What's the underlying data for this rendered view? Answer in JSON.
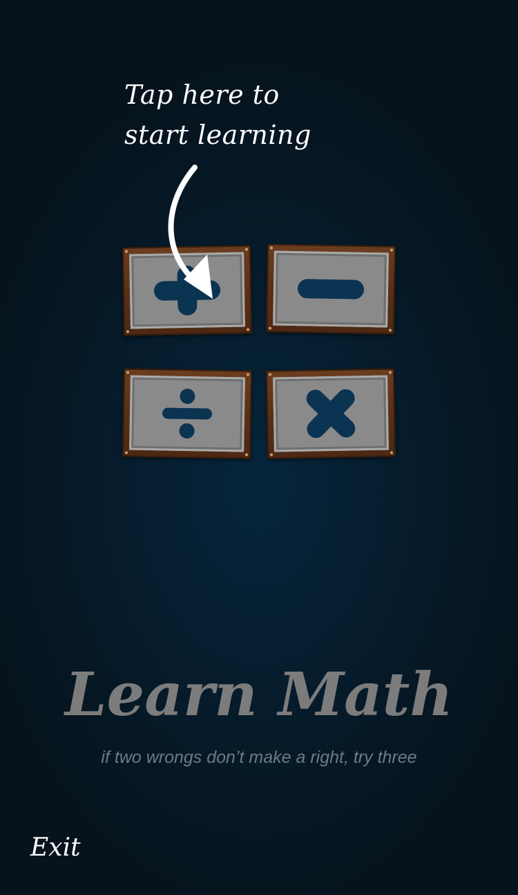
{
  "hint": {
    "line1": "Tap here to",
    "line2": "start learning"
  },
  "operations": [
    {
      "name": "addition",
      "icon": "plus-icon",
      "symbol": "+"
    },
    {
      "name": "subtraction",
      "icon": "minus-icon",
      "symbol": "−"
    },
    {
      "name": "division",
      "icon": "divide-icon",
      "symbol": "÷"
    },
    {
      "name": "multiplication",
      "icon": "times-icon",
      "symbol": "×"
    }
  ],
  "app": {
    "title": "Learn Math",
    "tagline": "if two wrongs don’t make a right, try three"
  },
  "footer": {
    "exit_label": "Exit"
  },
  "colors": {
    "background": "#061a28",
    "symbol": "#0b3352",
    "tile_frame": "#5a3016",
    "tile_face": "#8a8a8a",
    "title": "#7c7c7c",
    "tagline": "#6f7a84",
    "hint_text": "#ffffff"
  }
}
